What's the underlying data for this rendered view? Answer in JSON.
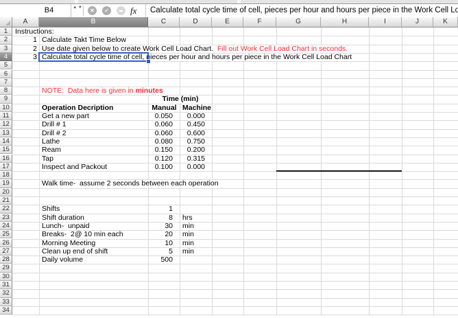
{
  "formula_bar": {
    "cell_reference": "B4",
    "fx_label": "fx",
    "formula_text": "Calculate total cycle time of cell, pieces per hour and hours per piece in the Work Cell Load Chart",
    "icons": {
      "cancel_glyph": "✕",
      "accept_glyph": "✓",
      "stepper_glyph": "▲\n▼"
    }
  },
  "colors": {
    "selection_blue": "#2e5fc9",
    "red_text": "#f32b38",
    "black_border": "#161616"
  },
  "grid": {
    "column_headers": [
      "A",
      "B",
      "C",
      "D",
      "E",
      "F",
      "G",
      "H",
      "I",
      "J",
      "K"
    ],
    "row_count": 34,
    "selection": {
      "cell": "B4",
      "column": "B",
      "row": 4
    },
    "borders": [
      {
        "from_col": "G",
        "to_col": "I",
        "row": 17,
        "edge": "bottom"
      }
    ],
    "cells": [
      {
        "ref": "A1",
        "col": "A",
        "row": 1,
        "text": "Instructions:"
      },
      {
        "ref": "A2",
        "col": "A",
        "row": 2,
        "text": "1",
        "align": "right"
      },
      {
        "ref": "B2",
        "col": "B",
        "row": 2,
        "text": "Calculate Takt Time Below"
      },
      {
        "ref": "A3",
        "col": "A",
        "row": 3,
        "text": "2",
        "align": "right"
      },
      {
        "ref": "B3",
        "col": "B",
        "row": 3,
        "overflow": true,
        "runs": [
          {
            "text": "Use date given below to create Work Cell Load Chart.  "
          },
          {
            "text": "Fill out Work Cell Load Chart in seconds.",
            "color": "red"
          }
        ]
      },
      {
        "ref": "A4",
        "col": "A",
        "row": 4,
        "text": "3",
        "align": "right"
      },
      {
        "ref": "B4",
        "col": "B",
        "row": 4,
        "overflow": true,
        "text": "Calculate total cycle time of cell, pieces per hour and hours per piece in the Work Cell Load Chart"
      },
      {
        "ref": "B8",
        "col": "B",
        "row": 8,
        "overflow": true,
        "runs": [
          {
            "text": "NOTE:  Data here is given in ",
            "color": "red"
          },
          {
            "text": "minutes",
            "color": "red",
            "bold": true
          }
        ]
      },
      {
        "ref": "C9",
        "col": "C",
        "row": 9,
        "span": 2,
        "merged": true,
        "text": "Time (min)",
        "align": "center",
        "bold": true
      },
      {
        "ref": "B10",
        "col": "B",
        "row": 10,
        "text": "Operation Decription",
        "bold": true
      },
      {
        "ref": "C10",
        "col": "C",
        "row": 10,
        "text": "Manual",
        "align": "center",
        "bold": true
      },
      {
        "ref": "D10",
        "col": "D",
        "row": 10,
        "text": "Machine",
        "align": "center",
        "bold": true
      },
      {
        "ref": "B11",
        "col": "B",
        "row": 11,
        "text": "Get a new part"
      },
      {
        "ref": "C11",
        "col": "C",
        "row": 11,
        "text": "0.050",
        "align": "right",
        "indent": true
      },
      {
        "ref": "D11",
        "col": "D",
        "row": 11,
        "text": "0.000",
        "align": "right",
        "indent": true
      },
      {
        "ref": "B12",
        "col": "B",
        "row": 12,
        "text": "Drill # 1"
      },
      {
        "ref": "C12",
        "col": "C",
        "row": 12,
        "text": "0.060",
        "align": "right",
        "indent": true
      },
      {
        "ref": "D12",
        "col": "D",
        "row": 12,
        "text": "0.450",
        "align": "right",
        "indent": true
      },
      {
        "ref": "B13",
        "col": "B",
        "row": 13,
        "text": "Drill # 2"
      },
      {
        "ref": "C13",
        "col": "C",
        "row": 13,
        "text": "0.060",
        "align": "right",
        "indent": true
      },
      {
        "ref": "D13",
        "col": "D",
        "row": 13,
        "text": "0.600",
        "align": "right",
        "indent": true
      },
      {
        "ref": "B14",
        "col": "B",
        "row": 14,
        "text": "Lathe"
      },
      {
        "ref": "C14",
        "col": "C",
        "row": 14,
        "text": "0.080",
        "align": "right",
        "indent": true
      },
      {
        "ref": "D14",
        "col": "D",
        "row": 14,
        "text": "0.750",
        "align": "right",
        "indent": true
      },
      {
        "ref": "B15",
        "col": "B",
        "row": 15,
        "text": "Ream"
      },
      {
        "ref": "C15",
        "col": "C",
        "row": 15,
        "text": "0.150",
        "align": "right",
        "indent": true
      },
      {
        "ref": "D15",
        "col": "D",
        "row": 15,
        "text": "0.200",
        "align": "right",
        "indent": true
      },
      {
        "ref": "B16",
        "col": "B",
        "row": 16,
        "text": "Tap"
      },
      {
        "ref": "C16",
        "col": "C",
        "row": 16,
        "text": "0.120",
        "align": "right",
        "indent": true
      },
      {
        "ref": "D16",
        "col": "D",
        "row": 16,
        "text": "0.315",
        "align": "right",
        "indent": true
      },
      {
        "ref": "B17",
        "col": "B",
        "row": 17,
        "text": "Inspect and Packout"
      },
      {
        "ref": "C17",
        "col": "C",
        "row": 17,
        "text": "0.100",
        "align": "right",
        "indent": true
      },
      {
        "ref": "D17",
        "col": "D",
        "row": 17,
        "text": "0.000",
        "align": "right",
        "indent": true
      },
      {
        "ref": "B19",
        "col": "B",
        "row": 19,
        "overflow": true,
        "text": "Walk time-  assume 2 seconds between each operation"
      },
      {
        "ref": "B22",
        "col": "B",
        "row": 22,
        "text": "Shifts"
      },
      {
        "ref": "C22",
        "col": "C",
        "row": 22,
        "text": "1",
        "align": "right",
        "indent": true
      },
      {
        "ref": "B23",
        "col": "B",
        "row": 23,
        "text": "Shift duration"
      },
      {
        "ref": "C23",
        "col": "C",
        "row": 23,
        "text": "8",
        "align": "right",
        "indent": true
      },
      {
        "ref": "D23",
        "col": "D",
        "row": 23,
        "text": "hrs"
      },
      {
        "ref": "B24",
        "col": "B",
        "row": 24,
        "text": "Lunch-  unpaid"
      },
      {
        "ref": "C24",
        "col": "C",
        "row": 24,
        "text": "30",
        "align": "right",
        "indent": true
      },
      {
        "ref": "D24",
        "col": "D",
        "row": 24,
        "text": "min"
      },
      {
        "ref": "B25",
        "col": "B",
        "row": 25,
        "text": "Breaks-  2@ 10 min each"
      },
      {
        "ref": "C25",
        "col": "C",
        "row": 25,
        "text": "20",
        "align": "right",
        "indent": true
      },
      {
        "ref": "D25",
        "col": "D",
        "row": 25,
        "text": "min"
      },
      {
        "ref": "B26",
        "col": "B",
        "row": 26,
        "text": "Morning Meeting"
      },
      {
        "ref": "C26",
        "col": "C",
        "row": 26,
        "text": "10",
        "align": "right",
        "indent": true
      },
      {
        "ref": "D26",
        "col": "D",
        "row": 26,
        "text": "min"
      },
      {
        "ref": "B27",
        "col": "B",
        "row": 27,
        "text": "Clean up end of shift"
      },
      {
        "ref": "C27",
        "col": "C",
        "row": 27,
        "text": "5",
        "align": "right",
        "indent": true
      },
      {
        "ref": "D27",
        "col": "D",
        "row": 27,
        "text": "min"
      },
      {
        "ref": "B28",
        "col": "B",
        "row": 28,
        "text": "Daily volume"
      },
      {
        "ref": "C28",
        "col": "C",
        "row": 28,
        "text": "500",
        "align": "right",
        "indent": true
      }
    ]
  }
}
